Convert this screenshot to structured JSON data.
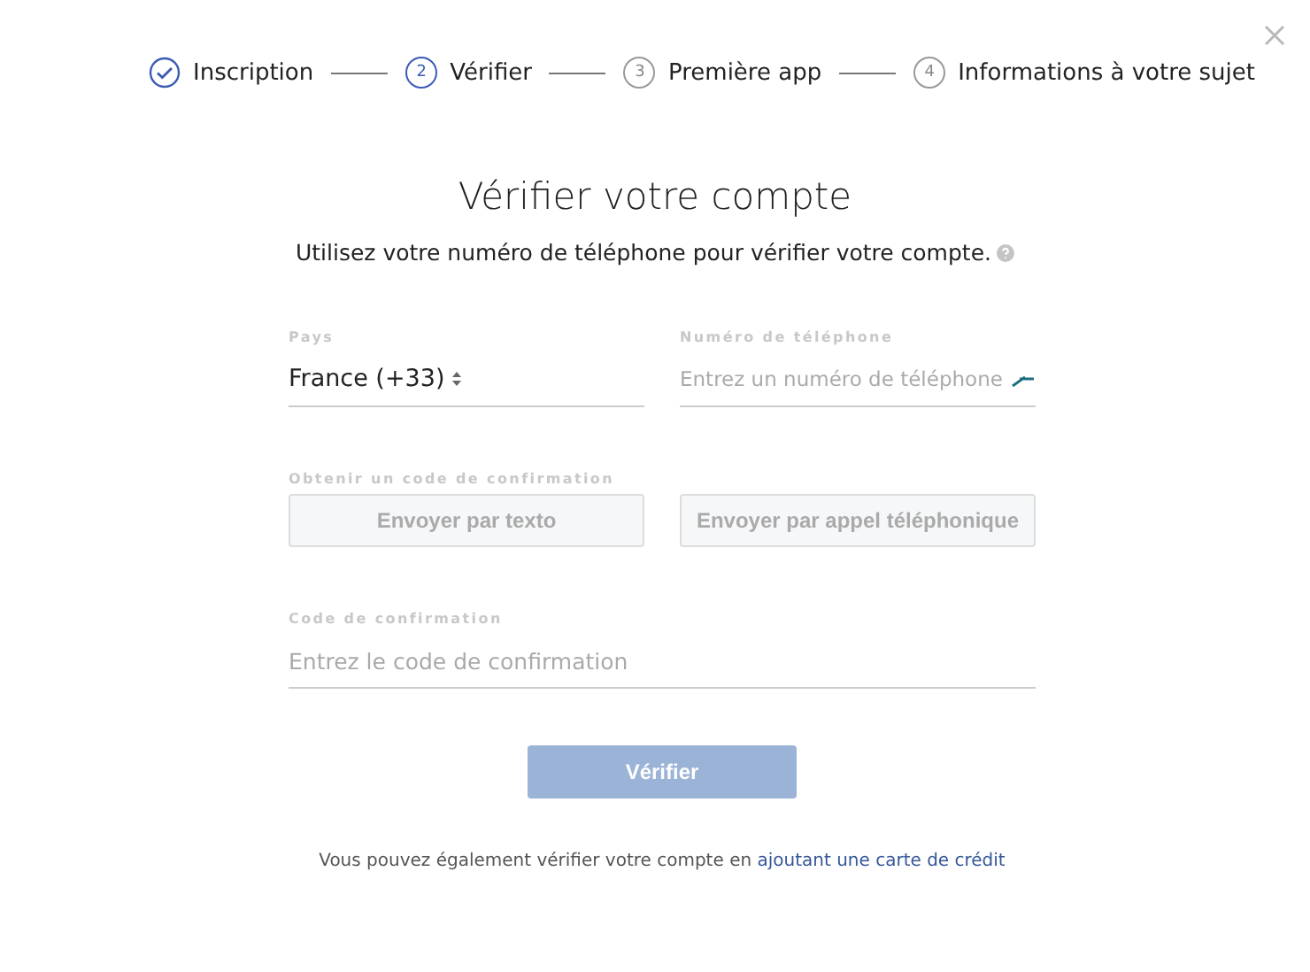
{
  "steps": [
    {
      "label": "Inscription",
      "done": true,
      "selected": false
    },
    {
      "number": "2",
      "label": "Vérifier",
      "done": false,
      "selected": true
    },
    {
      "number": "3",
      "label": "Première app",
      "done": false,
      "selected": false
    },
    {
      "number": "4",
      "label": "Informations à votre sujet",
      "done": false,
      "selected": false
    }
  ],
  "title": "Vérifier votre compte",
  "subtitle": "Utilisez votre numéro de téléphone pour vérifier votre compte.",
  "country": {
    "label": "Pays",
    "value": "France (+33)"
  },
  "phone": {
    "label": "Numéro de téléphone",
    "placeholder": "Entrez un numéro de téléphone"
  },
  "send": {
    "label": "Obtenir un code de confirmation",
    "buttons": [
      {
        "label": "Envoyer par texto",
        "disabled": true
      },
      {
        "label": "Envoyer par appel téléphonique",
        "disabled": true
      }
    ]
  },
  "code": {
    "label": "Code de confirmation",
    "placeholder": "Entrez le code de confirmation"
  },
  "verify": {
    "label": "Vérifier",
    "disabled": true
  },
  "footer": {
    "text": "Vous pouvez également vérifier votre compte en",
    "link": "ajoutant une carte de crédit"
  }
}
